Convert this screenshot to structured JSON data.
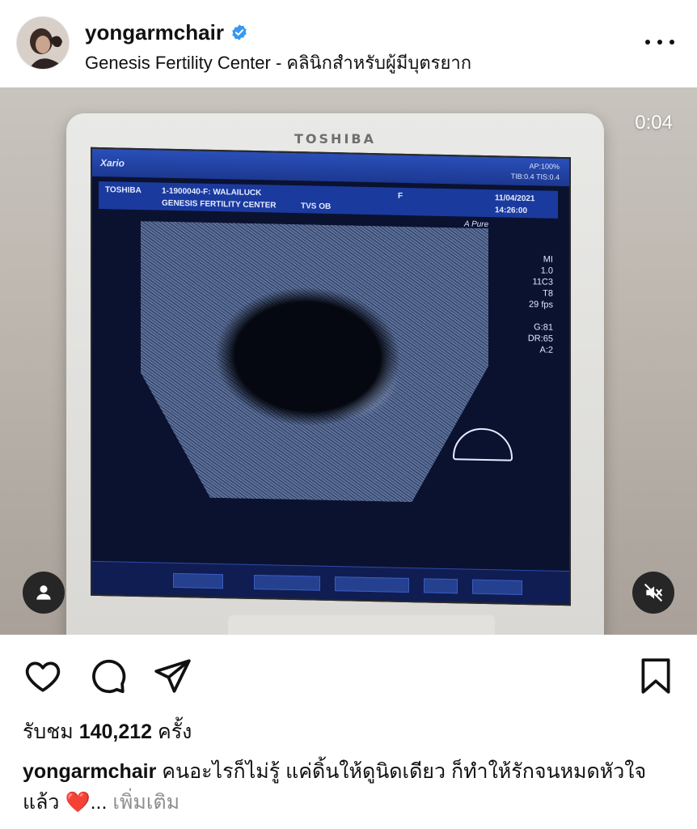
{
  "post": {
    "username": "yongarmchair",
    "location": "Genesis Fertility Center - คลินิกสำหรับผู้มีบุตรยาก",
    "verified": true
  },
  "video": {
    "timestamp": "0:04",
    "muted": true,
    "screen": {
      "brand": "TOSHIBA",
      "model": "Xario",
      "ap_line1": "AP:100%",
      "ap_line2": "TIB:0.4   TIS:0.4",
      "patient_brand": "TOSHIBA",
      "patient_id": "1-1900040-F: WALAILUCK",
      "sex": "F",
      "date": "11/04/2021",
      "clinic": "GENESIS FERTILITY CENTER",
      "exam": "TVS OB",
      "time": "14:26:00",
      "apure": "A Pure",
      "readout": [
        "MI",
        "1.0",
        "11C3",
        "T8",
        "29 fps",
        "G:81",
        "DR:65",
        "A:2"
      ]
    }
  },
  "engagement": {
    "views_label": "รับชม",
    "views_count": "140,212",
    "views_suffix": "ครั้ง"
  },
  "caption": {
    "username": "yongarmchair",
    "text": "คนอะไรก็ไม่รู้ แค่ดิ้นให้ดูนิดเดียว ก็ทำให้รักจนหมดหัวใจแล้ว",
    "emoji": "❤️",
    "ellipsis": "...",
    "more_label": "เพิ่มเติม"
  },
  "colors": {
    "verified_blue": "#3897f0",
    "heart_red": "#e0245e",
    "muted_gray": "#8e8e8e"
  },
  "icons": [
    "verified-badge-icon",
    "more-icon",
    "user-tag-icon",
    "mute-icon",
    "heart-icon",
    "comment-icon",
    "share-icon",
    "bookmark-icon"
  ]
}
